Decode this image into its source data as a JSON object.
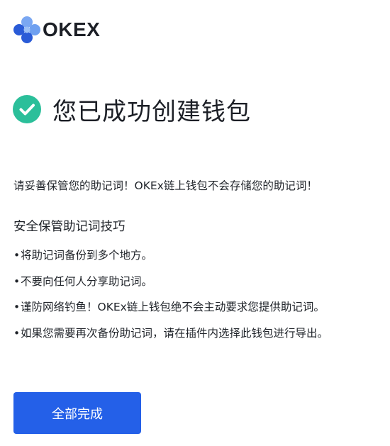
{
  "header": {
    "logo_text": "OKEX",
    "logo_icon": "okex-logo-icon"
  },
  "success": {
    "icon": "check-circle-icon",
    "title": "您已成功创建钱包"
  },
  "notice": "请妥善保管您的助记词！OKEx链上钱包不会存储您的助记词！",
  "tips": {
    "title": "安全保管助记词技巧",
    "items": [
      "将助记词备份到多个地方。",
      "不要向任何人分享助记词。",
      "谨防网络钓鱼！OKEx链上钱包绝不会主动要求您提供助记词。",
      "如果您需要再次备份助记词，请在插件内选择此钱包进行导出。"
    ]
  },
  "actions": {
    "done_label": "全部完成"
  },
  "colors": {
    "accent": "#2460e8",
    "success": "#2bbf9a",
    "logo_blue": "#2a5bd7",
    "logo_light_blue": "#6fa0f0"
  }
}
